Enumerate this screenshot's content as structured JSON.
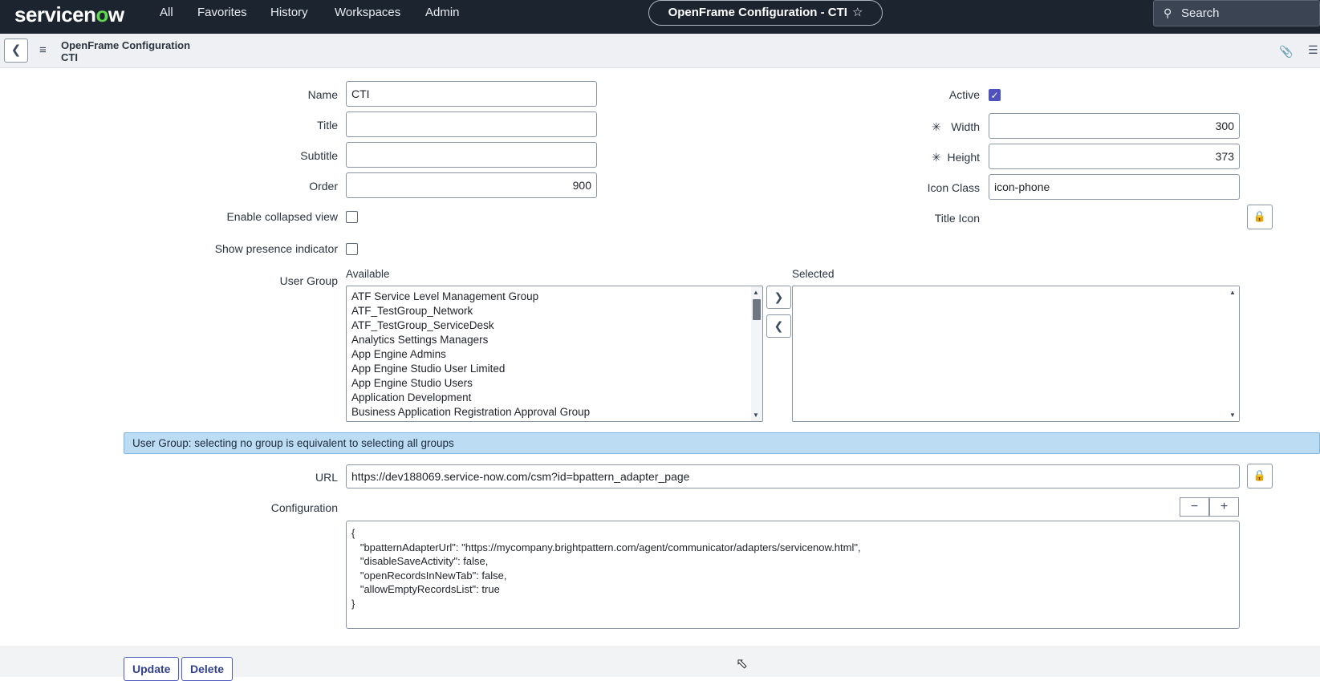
{
  "topnav": {
    "logo_part1": "servicen",
    "logo_o": "o",
    "logo_part2": "w",
    "menu": [
      "All",
      "Favorites",
      "History",
      "Workspaces",
      "Admin"
    ],
    "record_title": "OpenFrame Configuration - CTI",
    "star_icon": "star-outline-icon",
    "search_placeholder": "Search"
  },
  "header": {
    "back_icon": "chevron-left-icon",
    "menu_icon": "hamburger-icon",
    "table_name": "OpenFrame Configuration",
    "record_name": "CTI",
    "attachment_icon": "paperclip-icon",
    "settings_icon": "sliders-icon"
  },
  "form": {
    "name": {
      "label": "Name",
      "value": "CTI"
    },
    "title": {
      "label": "Title",
      "value": ""
    },
    "subtitle": {
      "label": "Subtitle",
      "value": ""
    },
    "order": {
      "label": "Order",
      "value": "900"
    },
    "enable_collapsed": {
      "label": "Enable collapsed view",
      "checked": false
    },
    "show_presence": {
      "label": "Show presence indicator",
      "checked": false
    },
    "active": {
      "label": "Active",
      "checked": true
    },
    "width": {
      "label": "Width",
      "value": "300",
      "required_mark": "✳"
    },
    "height": {
      "label": "Height",
      "value": "373",
      "required_mark": "✳"
    },
    "icon_class": {
      "label": "Icon Class",
      "value": "icon-phone"
    },
    "title_icon": {
      "label": "Title Icon"
    },
    "user_group": {
      "label": "User Group",
      "available_label": "Available",
      "selected_label": "Selected",
      "available": [
        "ATF Service Level Management Group",
        "ATF_TestGroup_Network",
        "ATF_TestGroup_ServiceDesk",
        "Analytics Settings Managers",
        "App Engine Admins",
        "App Engine Studio User Limited",
        "App Engine Studio Users",
        "Application Development",
        "Business Application Registration Approval Group"
      ],
      "selected": []
    },
    "info_message": "User Group: selecting no group is equivalent to selecting all groups",
    "url": {
      "label": "URL",
      "value": "https://dev188069.service-now.com/csm?id=bpattern_adapter_page"
    },
    "configuration": {
      "label": "Configuration",
      "value": "{\n   \"bpatternAdapterUrl\": \"https://mycompany.brightpattern.com/agent/communicator/adapters/servicenow.html\",\n   \"disableSaveActivity\": false,\n   \"openRecordsInNewTab\": false,\n   \"allowEmptyRecordsList\": true\n}"
    }
  },
  "footer": {
    "update_label": "Update",
    "delete_label": "Delete"
  },
  "colors": {
    "nav_bg": "#1c2430",
    "accent": "#4f52bd",
    "info_bg": "#bcdcf4",
    "logo_o": "#62d84e"
  }
}
